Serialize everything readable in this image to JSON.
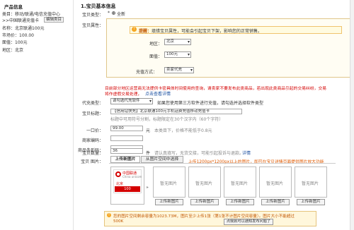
{
  "sidebar": {
    "title": "产品信息",
    "category_line1": "类目：移动/联通/电信充值中心",
    "category_line2": ">>中国联通充值卡",
    "edit_category_button": "编辑类目",
    "name": "名称：北京联通100元",
    "market_price": "市场价：100.00",
    "face_value": "面值：100元",
    "region": "地区：北京"
  },
  "section_title": "1.宝贝基本信息",
  "item_type": {
    "label": "宝贝类型：",
    "option": "全新"
  },
  "attributes": {
    "label": "宝贝属性：",
    "tip_label": "提醒：",
    "tip_text": "填错宝贝属性，可能会引起宝贝下架，影响您的正常销售。",
    "region_label": "地区：",
    "region_value": "北京",
    "face_label": "面值：",
    "face_value": "100元",
    "method_label": "充值方式：",
    "method_value": "卖家代充"
  },
  "warning_line1": "目前部分地区运营商无法提供卡密具体时间使用的查询，请卖家不要发布此类商品，若出现此类商品引起的交易纠纷，交易",
  "warning_line2": "将作虚假交易处理，",
  "warning_link": "点击查看详情",
  "agent": {
    "label": "代充类型：",
    "value": "请勾选代充软件",
    "text": "如果您使用第三方软件进行充值，请勾选并选择软件类型"
  },
  "title": {
    "label": "宝贝标题：",
    "value": "【信用钻快充】北京联通100元手机话费充值移动充值卡",
    "hint": "标题中可用符号分割，标题限定在30个汉字内（60个字符）"
  },
  "price": {
    "label": "一口价：",
    "value": "99.00",
    "unit": "元",
    "hint": "本类目下，价格不能低于0.8元"
  },
  "merchant_code": {
    "label": "商家编码："
  },
  "barcode": {
    "label": "商品条形码："
  },
  "quantity": {
    "label": "宝贝数量：",
    "value": "36",
    "unit": "件",
    "hint": "请认真填写，无货交接，可能引起投诉与退款。",
    "link": "详情"
  },
  "images": {
    "label": "宝贝 图片：",
    "tab_upload": "上传新图片",
    "tab_space": "从图片空间中选择",
    "hint": "上传1200px*1200px以上的图片，即可在宝贝详情页面提供图片放大功能",
    "main_card_brand": "中国联通",
    "main_card_en": "China unicom",
    "main_card_sub": "北京",
    "main_card_value": "100",
    "no_image": "暂无图片",
    "upload_button": "上传新图片"
  },
  "space_info": {
    "line1": "您的图片空间剩余容量为1023.73M，图片至少上传1张（第1张不计图片空间容量）。图片大小不能超过",
    "line2": "500K",
    "button": "点我就可以通知发布问题了"
  }
}
